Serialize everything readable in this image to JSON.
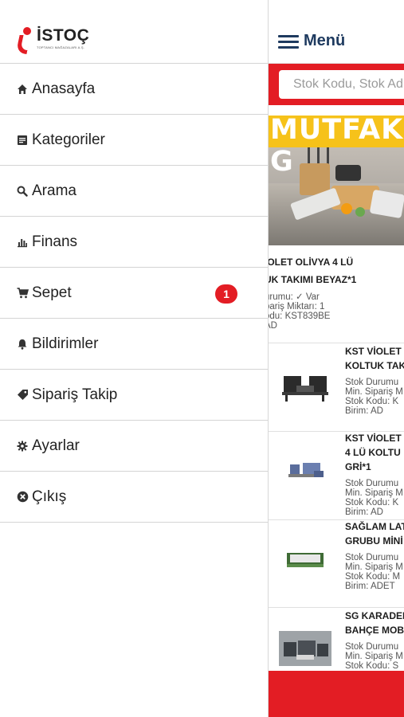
{
  "brand": {
    "logo_text": "İSTOÇ",
    "logo_subtitle": "TOPTANCI MAĞAZALARI A.Ş."
  },
  "drawer": {
    "items": [
      {
        "label": "Anasayfa",
        "icon": "home-icon"
      },
      {
        "label": "Kategoriler",
        "icon": "list-icon"
      },
      {
        "label": "Arama",
        "icon": "search-icon"
      },
      {
        "label": "Finans",
        "icon": "bar-chart-icon"
      },
      {
        "label": "Sepet",
        "icon": "cart-icon",
        "badge": "1"
      },
      {
        "label": "Bildirimler",
        "icon": "bell-icon"
      },
      {
        "label": "Sipariş Takip",
        "icon": "tag-icon"
      },
      {
        "label": "Ayarlar",
        "icon": "gear-icon"
      },
      {
        "label": "Çıkış",
        "icon": "close-circle-icon"
      }
    ]
  },
  "main": {
    "menu_title": "Menü",
    "search_placeholder": "Stok Kodu, Stok Adı",
    "banner_text": "MUTFAK G",
    "first_product": {
      "name_line1": "İOLET OLİVYA 4 LÜ",
      "name_line2": "UK TAKIMI BEYAZ*1",
      "info_line1": "urumu: ✓ Var",
      "info_line2": "pariş Miktarı: 1",
      "info_line3": "odu: KST839BE",
      "info_line4": "AD"
    },
    "products": [
      {
        "name_line1": "KST VİOLET",
        "name_line2": "KOLTUK TAK",
        "name_line3": "",
        "info_line1": "Stok Durumu",
        "info_line2": "Min. Sipariş M",
        "info_line3": "Stok Kodu: K",
        "info_line4": "Birim: AD"
      },
      {
        "name_line1": "KST VİOLET",
        "name_line2": "4 LÜ KOLTU",
        "name_line3": "GRİ*1",
        "info_line1": "Stok Durumu",
        "info_line2": "Min. Sipariş M",
        "info_line3": "Stok Kodu: K",
        "info_line4": "Birim: AD"
      },
      {
        "name_line1": "SAĞLAM LAT",
        "name_line2": "GRUBU MİNİ",
        "name_line3": "",
        "info_line1": "Stok Durumu",
        "info_line2": "Min. Sipariş M",
        "info_line3": "Stok Kodu: M",
        "info_line4": "Birim: ADET"
      },
      {
        "name_line1": "SG KARADEN",
        "name_line2": "BAHÇE MOB",
        "name_line3": "",
        "info_line1": "Stok Durumu",
        "info_line2": "Min. Sipariş M",
        "info_line3": "Stok Kodu: S",
        "info_line4": ""
      }
    ]
  },
  "colors": {
    "accent_red": "#e31d24",
    "nav_blue": "#1e3a5f"
  }
}
